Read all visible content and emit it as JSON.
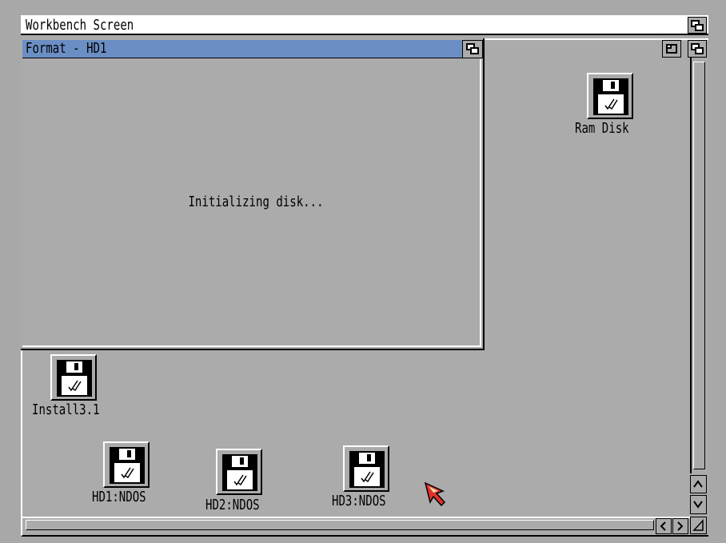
{
  "screen": {
    "title": "Workbench Screen"
  },
  "format_window": {
    "title": "Format - HD1",
    "message": "Initializing disk..."
  },
  "icons": [
    {
      "label": "Ram Disk"
    },
    {
      "label": "Install3.1"
    },
    {
      "label": "HD1:NDOS"
    },
    {
      "label": "HD2:NDOS"
    },
    {
      "label": "HD3:NDOS"
    }
  ],
  "colors": {
    "title_active": "#6b8fc4",
    "background": "#ababab",
    "pointer": "#e0322a"
  }
}
